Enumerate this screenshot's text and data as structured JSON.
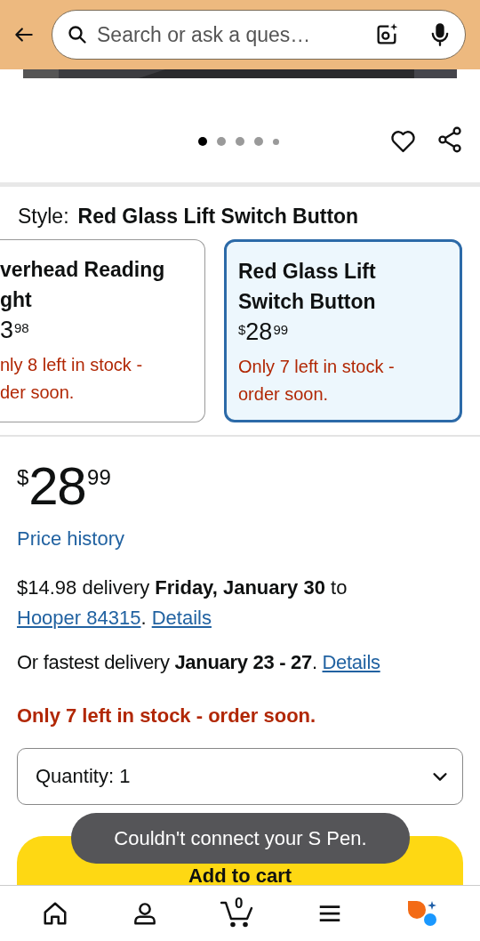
{
  "header": {
    "search": {
      "placeholder": "Search or ask a ques…"
    }
  },
  "gallery": {
    "dots": [
      {
        "selected": true,
        "kind": "dot"
      },
      {
        "selected": false,
        "kind": "dot"
      },
      {
        "selected": false,
        "kind": "dot"
      },
      {
        "selected": false,
        "kind": "dot"
      },
      {
        "selected": false,
        "kind": "small"
      }
    ]
  },
  "style": {
    "label": "Style:",
    "value": "Red Glass Lift Switch Button"
  },
  "options": [
    {
      "selected": false,
      "title_lines": [
        "verhead Reading",
        "ght"
      ],
      "price": {
        "whole": "3",
        "fraction": "98"
      },
      "stock_lines": [
        "nly 8 left in stock -",
        "der soon."
      ]
    },
    {
      "selected": true,
      "title_lines": [
        "Red Glass Lift",
        "Switch Button"
      ],
      "price": {
        "symbol": "$",
        "whole": "28",
        "fraction": "99"
      },
      "stock_lines": [
        "Only 7 left in stock -",
        "order soon."
      ]
    }
  ],
  "price": {
    "symbol": "$",
    "whole": "28",
    "fraction": "99"
  },
  "price_history": "Price history",
  "delivery": {
    "text": "$14.98 delivery **Friday, January 30** to",
    "address": "Hooper 84315",
    "separator": ".",
    "details": "Details"
  },
  "fastest": {
    "text": "Or fastest delivery **January 23 - 27**",
    "separator": ".",
    "details": "Details"
  },
  "stock": "Only 7 left in stock - order soon.",
  "quantity": {
    "value": "Quantity: 1"
  },
  "add_to_cart": "Add to cart",
  "toast": "Couldn't connect your S Pen.",
  "nav": [
    {
      "kind": "home"
    },
    {
      "kind": "account"
    },
    {
      "kind": "cart",
      "badge": "0"
    },
    {
      "kind": "menu"
    },
    {
      "kind": "assistant"
    }
  ]
}
